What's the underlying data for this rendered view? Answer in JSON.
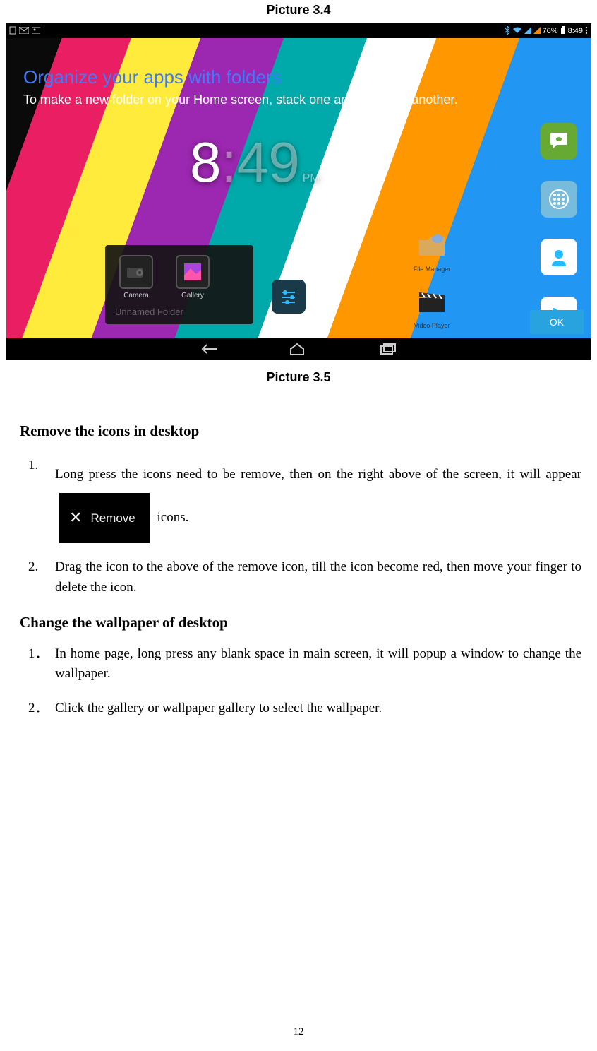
{
  "captions": {
    "above": "Picture 3.4",
    "below": "Picture 3.5"
  },
  "screenshot": {
    "status": {
      "battery_pct": "76%",
      "time": "8:49"
    },
    "tip": {
      "title": "Organize your apps with folders",
      "body": "To make a new folder on your Home screen, stack one app on top of another."
    },
    "clock": {
      "hour": "8",
      "sep": ":",
      "mins": "49",
      "ampm": "PM"
    },
    "folder": {
      "apps": [
        {
          "label": "Camera"
        },
        {
          "label": "Gallery"
        }
      ],
      "title": "Unnamed Folder"
    },
    "settings_label": "Settings",
    "side_apps": {
      "fm": "File Manager",
      "vp": "Video Player"
    },
    "ok": "OK"
  },
  "sections": {
    "remove": {
      "heading": "Remove the icons in desktop",
      "items": [
        {
          "num": "1.",
          "pre": "Long press the icons need to be remove, then on the right above of the screen, it will appear",
          "chip": "Remove",
          "post": " icons."
        },
        {
          "num": "2.",
          "text": "Drag the icon to the above of the remove icon, till the icon become red, then move your finger to delete the icon."
        }
      ]
    },
    "wallpaper": {
      "heading": "Change the wallpaper of desktop",
      "items": [
        {
          "num": "1．",
          "text": "In home page, long press any blank space in main screen, it will popup a window to change the wallpaper."
        },
        {
          "num": "2．",
          "text": "Click the gallery or wallpaper gallery to select the wallpaper."
        }
      ]
    }
  },
  "page_number": "12"
}
